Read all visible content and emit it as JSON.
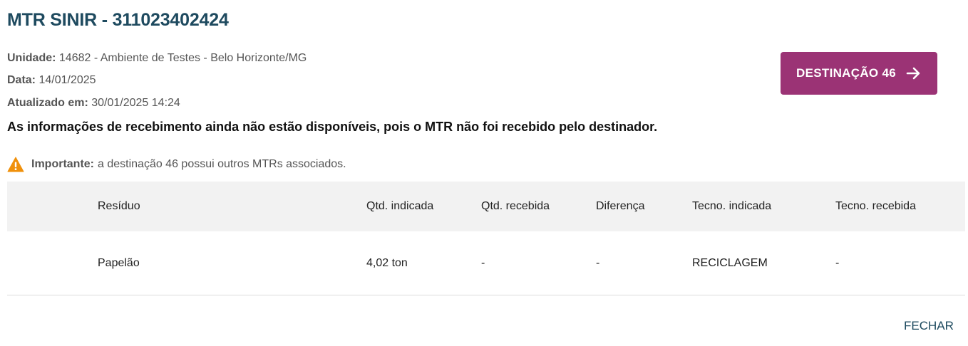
{
  "header": {
    "title": "MTR SINIR - 311023402424"
  },
  "info": {
    "unidade_label": "Unidade:",
    "unidade_value": "14682 - Ambiente de Testes - Belo Horizonte/MG",
    "data_label": "Data:",
    "data_value": "14/01/2025",
    "atualizado_label": "Atualizado em:",
    "atualizado_value": "30/01/2025 14:24",
    "notice": "As informações de recebimento ainda não estão disponíveis, pois o MTR não foi recebido pelo destinador."
  },
  "destination_button": {
    "label": "DESTINAÇÃO 46",
    "icon": "arrow-right-icon",
    "color": "#9b3375"
  },
  "warning": {
    "icon": "warning-icon",
    "icon_color": "#f0900a",
    "label": "Importante:",
    "text": "a destinação 46 possui outros MTRs associados."
  },
  "table": {
    "columns": [
      "Resíduo",
      "Qtd. indicada",
      "Qtd. recebida",
      "Diferença",
      "Tecno. indicada",
      "Tecno. recebida"
    ],
    "rows": [
      [
        "Papelão",
        "4,02 ton",
        "-",
        "-",
        "RECICLAGEM",
        "-"
      ]
    ]
  },
  "footer": {
    "close_label": "FECHAR"
  },
  "colors": {
    "title": "#1e4a5f",
    "header_bg": "#f2f2f2"
  }
}
